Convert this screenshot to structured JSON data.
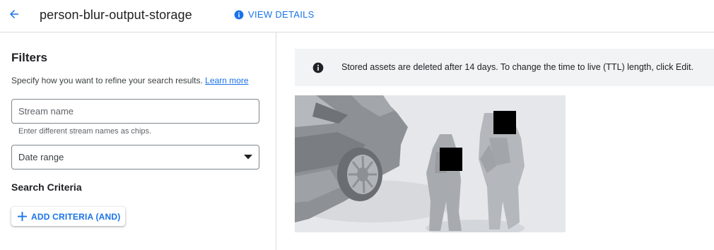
{
  "header": {
    "title": "person-blur-output-storage",
    "details_label": "VIEW DETAILS"
  },
  "filters": {
    "heading": "Filters",
    "hint": "Specify how you want to refine your search results.",
    "learn_more": "Learn more",
    "stream_placeholder": "Stream name",
    "stream_helper": "Enter different stream names as chips.",
    "date_range_label": "Date range",
    "criteria_heading": "Search Criteria",
    "add_criteria_label": "ADD CRITERIA (AND)"
  },
  "banner": {
    "text": "Stored assets are deleted after 14 days. To change the time to live (TTL) length, click Edit."
  },
  "colors": {
    "accent": "#1a73e8",
    "banner_bg": "#f1f3f4"
  },
  "icons": {
    "back": "arrow-back-icon",
    "info": "info-icon",
    "dropdown": "dropdown-arrow-icon",
    "add": "plus-icon"
  }
}
